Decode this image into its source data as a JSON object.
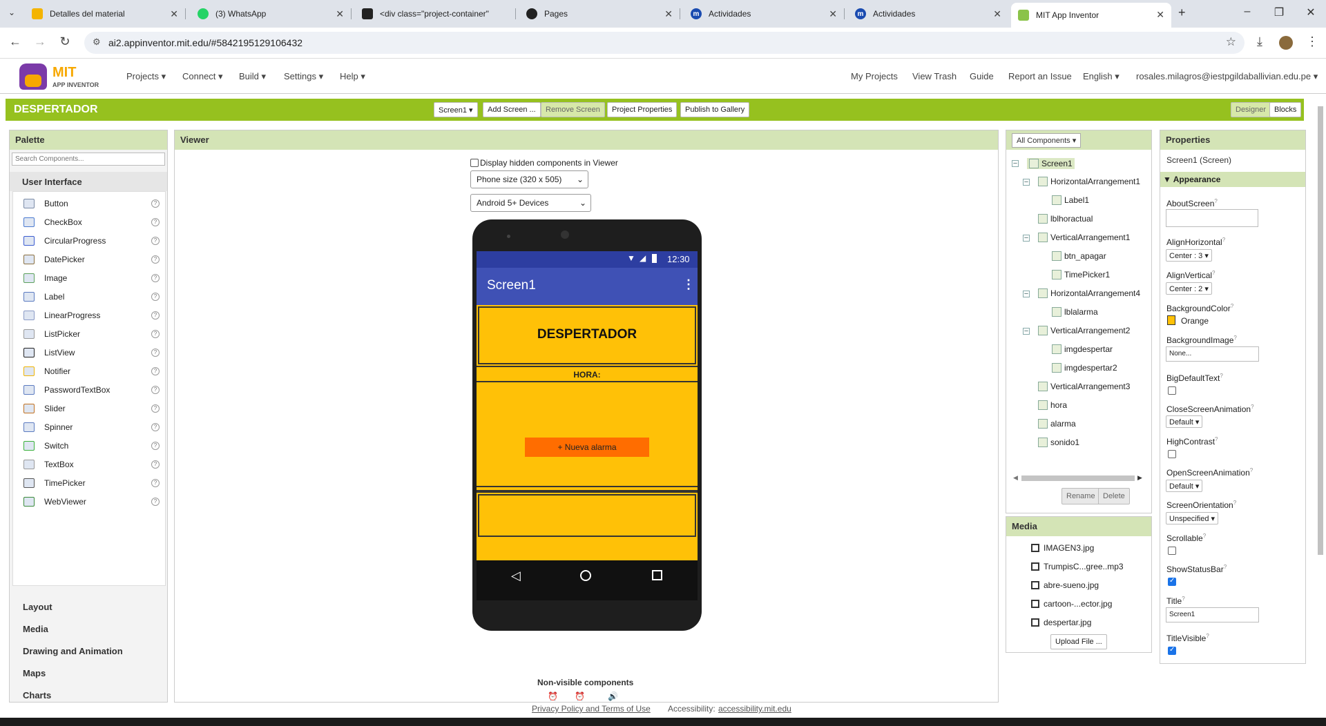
{
  "browser": {
    "tabs": [
      {
        "title": "Detalles del material",
        "icon": "classroom-icon"
      },
      {
        "title": "(3) WhatsApp",
        "icon": "whatsapp-icon"
      },
      {
        "title": "<div class=\"project-container\"",
        "icon": "code-icon"
      },
      {
        "title": "Pages",
        "icon": "github-icon"
      },
      {
        "title": "Actividades",
        "icon": "moodle-icon"
      },
      {
        "title": "Actividades",
        "icon": "moodle-icon"
      },
      {
        "title": "MIT App Inventor",
        "icon": "appinventor-icon"
      }
    ],
    "url": "ai2.appinventor.mit.edu/#5842195129106432"
  },
  "header": {
    "logo_top": "MIT",
    "logo_bottom": "APP INVENTOR",
    "menus": [
      "Projects",
      "Connect",
      "Build",
      "Settings",
      "Help"
    ],
    "right_links": [
      "My Projects",
      "View Trash",
      "Guide",
      "Report an Issue",
      "English"
    ],
    "user": "rosales.milagros@iestpgildaballivian.edu.pe"
  },
  "toolbar": {
    "project_name": "DESPERTADOR",
    "screen_select": "Screen1",
    "add_screen": "Add Screen ...",
    "remove_screen": "Remove Screen",
    "project_properties": "Project Properties",
    "publish": "Publish to Gallery",
    "designer": "Designer",
    "blocks": "Blocks"
  },
  "palette": {
    "title": "Palette",
    "search_placeholder": "Search Components...",
    "category": "User Interface",
    "items": [
      "Button",
      "CheckBox",
      "CircularProgress",
      "DatePicker",
      "Image",
      "Label",
      "LinearProgress",
      "ListPicker",
      "ListView",
      "Notifier",
      "PasswordTextBox",
      "Slider",
      "Spinner",
      "Switch",
      "TextBox",
      "TimePicker",
      "WebViewer"
    ],
    "other_categories": [
      "Layout",
      "Media",
      "Drawing and Animation",
      "Maps",
      "Charts"
    ]
  },
  "viewer": {
    "title": "Viewer",
    "hidden_checkbox_label": "Display hidden components in Viewer",
    "phone_size": "Phone size (320 x 505)",
    "device": "Android 5+ Devices",
    "status_time": "12:30",
    "screen_title": "Screen1",
    "app_title": "DESPERTADOR",
    "hora_label": "HORA:",
    "alarm_button": "+ Nueva alarma",
    "non_visible": "Non-visible components"
  },
  "components": {
    "header": "All Components",
    "tree": [
      {
        "name": "Screen1",
        "level": 0
      },
      {
        "name": "HorizontalArrangement1",
        "level": 1
      },
      {
        "name": "Label1",
        "level": 2
      },
      {
        "name": "lblhoractual",
        "level": 1
      },
      {
        "name": "VerticalArrangement1",
        "level": 1
      },
      {
        "name": "btn_apagar",
        "level": 2
      },
      {
        "name": "TimePicker1",
        "level": 2
      },
      {
        "name": "HorizontalArrangement4",
        "level": 1
      },
      {
        "name": "lblalarma",
        "level": 2
      },
      {
        "name": "VerticalArrangement2",
        "level": 1
      },
      {
        "name": "imgdespertar",
        "level": 2
      },
      {
        "name": "imgdespertar2",
        "level": 2
      },
      {
        "name": "VerticalArrangement3",
        "level": 1
      },
      {
        "name": "hora",
        "level": 1
      },
      {
        "name": "alarma",
        "level": 1
      },
      {
        "name": "sonido1",
        "level": 1
      }
    ],
    "rename": "Rename",
    "delete": "Delete"
  },
  "media": {
    "title": "Media",
    "files": [
      "IMAGEN3.jpg",
      "TrumpisC...gree..mp3",
      "abre-sueno.jpg",
      "cartoon-...ector.jpg",
      "despertar.jpg"
    ],
    "upload": "Upload File ..."
  },
  "properties": {
    "title": "Properties",
    "subject": "Screen1 (Screen)",
    "section": "Appearance",
    "about_screen": "AboutScreen",
    "align_h": "AlignHorizontal",
    "align_h_val": "Center : 3",
    "align_v": "AlignVertical",
    "align_v_val": "Center : 2",
    "bgcolor": "BackgroundColor",
    "bgcolor_val": "Orange",
    "bgimage": "BackgroundImage",
    "bgimage_val": "None...",
    "bigtext": "BigDefaultText",
    "close_anim": "CloseScreenAnimation",
    "close_anim_val": "Default",
    "high_contrast": "HighContrast",
    "open_anim": "OpenScreenAnimation",
    "open_anim_val": "Default",
    "orientation": "ScreenOrientation",
    "orientation_val": "Unspecified",
    "scrollable": "Scrollable",
    "statusbar": "ShowStatusBar",
    "title_prop": "Title",
    "title_val": "Screen1",
    "title_visible": "TitleVisible"
  },
  "footer": {
    "privacy": "Privacy Policy and Terms of Use",
    "accessibility": "Accessibility:",
    "accessibility_link": "accessibility.mit.edu"
  },
  "colors": {
    "green": "#96c11f",
    "orange_screen": "#ffc107",
    "appbar": "#3f51b5",
    "button": "#ff6d00"
  }
}
